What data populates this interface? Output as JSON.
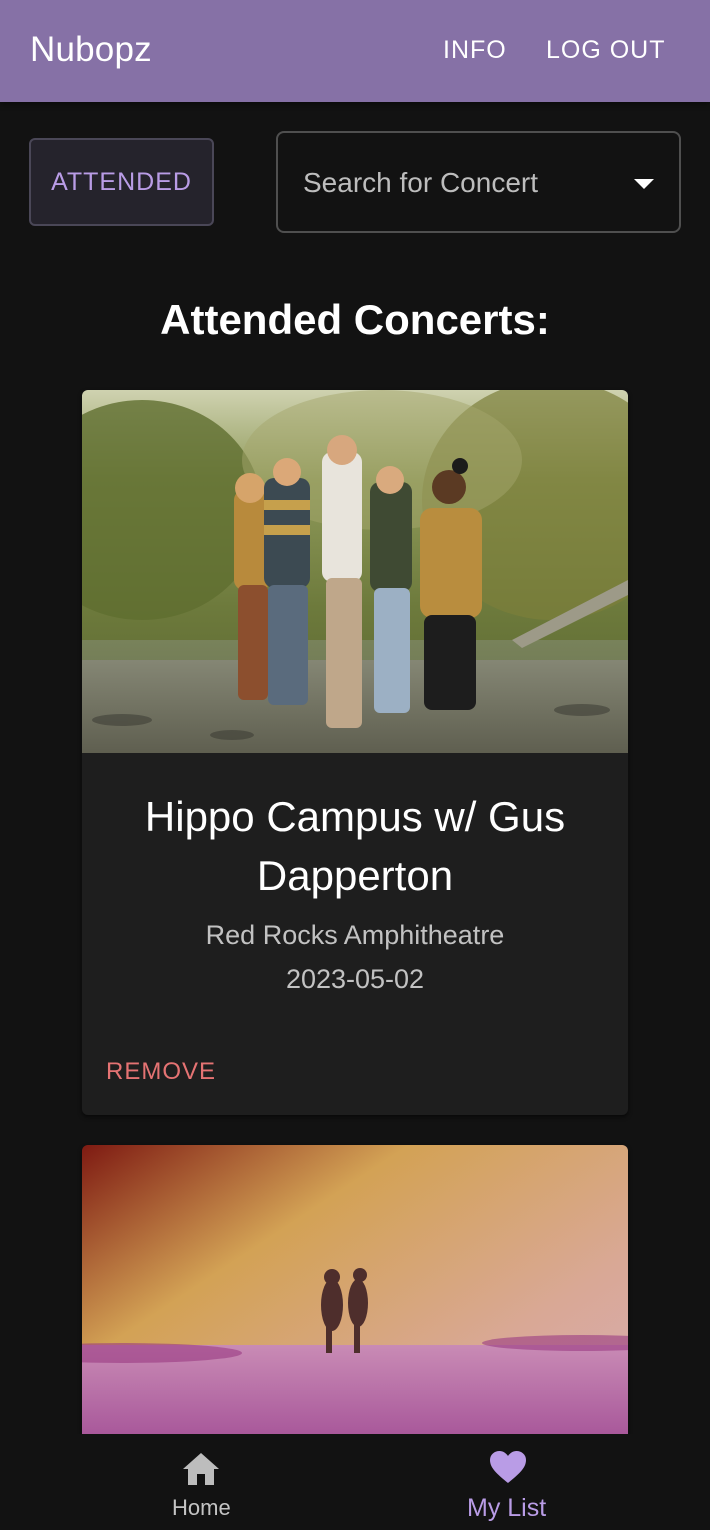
{
  "app_bar": {
    "brand": "Nubopz",
    "info_label": "INFO",
    "logout_label": "LOG OUT",
    "color": "#8671a6"
  },
  "filters": {
    "attended_label": "ATTENDED",
    "search_placeholder": "Search for Concert"
  },
  "section_title": "Attended Concerts:",
  "concerts": [
    {
      "title": "Hippo Campus w/ Gus Dapperton",
      "venue": "Red Rocks Amphitheatre",
      "date": "2023-05-02",
      "remove_label": "REMOVE"
    },
    {
      "title": "",
      "venue": "",
      "date": ""
    }
  ],
  "bottom_nav": {
    "home_label": "Home",
    "home_icon": "home-icon",
    "mylist_label": "My List",
    "mylist_icon": "heart-icon",
    "active_color": "#b99ce6"
  }
}
